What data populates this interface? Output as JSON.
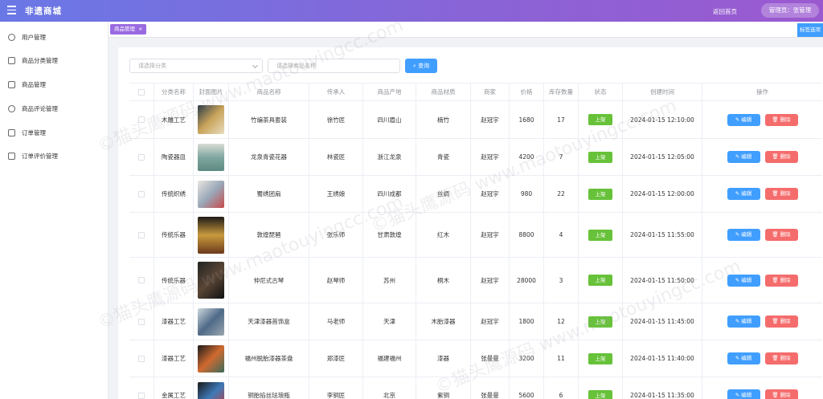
{
  "header": {
    "title": "非遗商城",
    "home_link": "返回首页",
    "admin": "管理员：张管理"
  },
  "sidebar": {
    "items": [
      {
        "label": "用户管理",
        "icon": "user-icon"
      },
      {
        "label": "商品分类管理",
        "icon": "copy-icon"
      },
      {
        "label": "商品管理",
        "icon": "goods-icon"
      },
      {
        "label": "商品评论管理",
        "icon": "chat-icon"
      },
      {
        "label": "订单管理",
        "icon": "order-icon"
      },
      {
        "label": "订单评价管理",
        "icon": "rating-icon"
      }
    ]
  },
  "tabs": {
    "active": "商品管理",
    "close": "×",
    "options": "标签选项"
  },
  "filters": {
    "category_placeholder": "请选择分类",
    "name_placeholder": "请选择商品名称",
    "search_label": "查询"
  },
  "table": {
    "headers": [
      "分类名称",
      "封面图片",
      "商品名称",
      "传承人",
      "商品产地",
      "商品材质",
      "商家",
      "价格",
      "库存数量",
      "状态",
      "创建时间",
      "操作"
    ],
    "status_label": "上架",
    "edit_label": "编辑",
    "delete_label": "删除",
    "rows": [
      {
        "category": "木雕工艺",
        "name": "竹编茶具套装",
        "inheritor": "徐竹匠",
        "origin": "四川眉山",
        "material": "楠竹",
        "merchant": "赵冠宇",
        "price": "1680",
        "stock": "17",
        "created": "2024-01-15 12:10:00"
      },
      {
        "category": "陶瓷器皿",
        "name": "龙泉青瓷花器",
        "inheritor": "林瓷匠",
        "origin": "浙江龙泉",
        "material": "青瓷",
        "merchant": "赵冠宇",
        "price": "4200",
        "stock": "7",
        "created": "2024-01-15 12:05:00"
      },
      {
        "category": "传统织绣",
        "name": "蜀绣团扇",
        "inheritor": "王绣娘",
        "origin": "四川成都",
        "material": "丝绸",
        "merchant": "赵冠宇",
        "price": "980",
        "stock": "22",
        "created": "2024-01-15 12:00:00"
      },
      {
        "category": "传统乐器",
        "name": "敦煌琵琶",
        "inheritor": "张乐师",
        "origin": "甘肃敦煌",
        "material": "红木",
        "merchant": "赵冠宇",
        "price": "8800",
        "stock": "4",
        "created": "2024-01-15 11:55:00"
      },
      {
        "category": "传统乐器",
        "name": "仲尼式古琴",
        "inheritor": "赵琴师",
        "origin": "苏州",
        "material": "桐木",
        "merchant": "赵冠宇",
        "price": "28000",
        "stock": "3",
        "created": "2024-01-15 11:50:00"
      },
      {
        "category": "漆器工艺",
        "name": "天津漆器首饰盒",
        "inheritor": "马老师",
        "origin": "天津",
        "material": "木胎漆器",
        "merchant": "赵冠宇",
        "price": "1800",
        "stock": "12",
        "created": "2024-01-15 11:45:00"
      },
      {
        "category": "漆器工艺",
        "name": "福州脱胎漆器茶盘",
        "inheritor": "郑漆匠",
        "origin": "福建福州",
        "material": "漆器",
        "merchant": "张曼曼",
        "price": "3200",
        "stock": "11",
        "created": "2024-01-15 11:40:00"
      },
      {
        "category": "金属工艺",
        "name": "铜胎掐丝珐琅瓶",
        "inheritor": "李铜匠",
        "origin": "北京",
        "material": "紫铜",
        "merchant": "张曼曼",
        "price": "5600",
        "stock": "6",
        "created": "2024-01-15 11:35:00"
      }
    ]
  },
  "watermark": "©猫头鹰源码 www.maotouyingcc.com",
  "colors": {
    "primary": "#409eff",
    "success": "#67c23a",
    "danger": "#f56c6c",
    "header_start": "#6a78e6",
    "header_end": "#9b59d0",
    "tab": "#9a6be0"
  }
}
